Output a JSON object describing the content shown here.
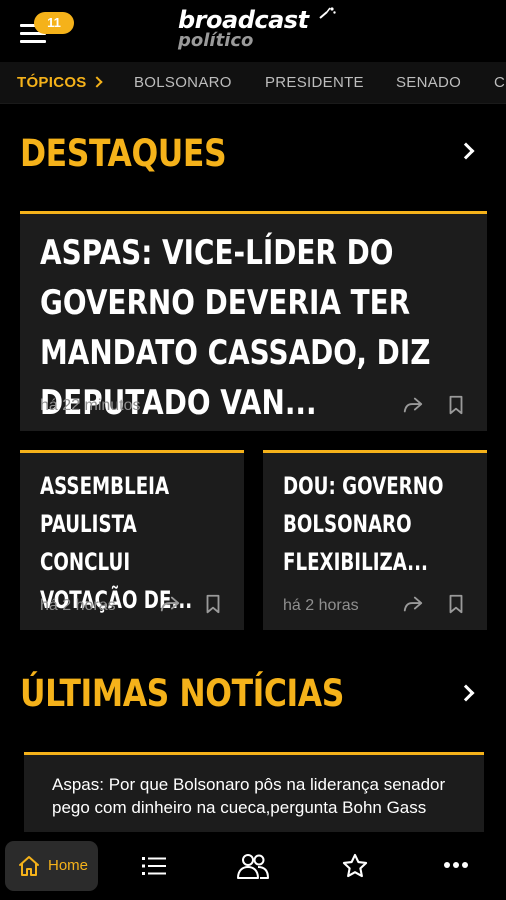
{
  "header": {
    "notification_count": "11",
    "logo_main": "broadcast",
    "logo_sub": "político"
  },
  "topics": [
    {
      "label": "TÓPICOS"
    },
    {
      "label": "BOLSONARO"
    },
    {
      "label": "PRESIDENTE"
    },
    {
      "label": "SENADO"
    },
    {
      "label": "C"
    }
  ],
  "destaques": {
    "title": "DESTAQUES",
    "featured": {
      "title": "ASPAS: VICE-LÍDER DO GOVERNO DEVERIA TER MANDATO CASSADO, DIZ DEPUTADO VAN...",
      "time": "há 22 minutos"
    },
    "cards": [
      {
        "title": "ASSEMBLEIA PAULISTA CONCLUI VOTAÇÃO DE...",
        "time": "há 2 horas"
      },
      {
        "title": "DOU: GOVERNO BOLSONARO FLEXIBILIZA...",
        "time": "há 2 horas"
      }
    ]
  },
  "ultimas": {
    "title": "ÚLTIMAS NOTÍCIAS",
    "items": [
      {
        "text": "Aspas: Por que Bolsonaro pôs na liderança senador pego com dinheiro na cueca,pergunta Bohn Gass"
      }
    ]
  },
  "bottom_nav": {
    "home_label": "Home",
    "icons": [
      "home-icon",
      "list-icon",
      "people-icon",
      "star-icon",
      "more-icon"
    ]
  },
  "colors": {
    "accent": "#f5b21a",
    "background": "#000000",
    "card": "#1c1c1c"
  }
}
